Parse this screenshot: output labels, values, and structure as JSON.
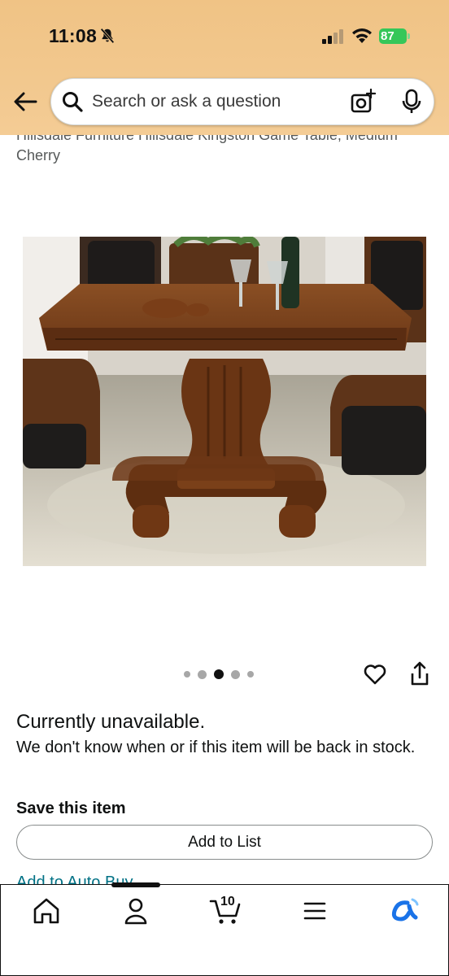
{
  "status_bar": {
    "time": "11:08",
    "battery": "87"
  },
  "search": {
    "placeholder": "Search or ask a question"
  },
  "product": {
    "title": "Hillsdale Furniture Hillsdale Kingston Game Table, Medium Cherry",
    "image_description": "Octagonal wood game table with pedestal base and leather chairs",
    "carousel": {
      "count": 5,
      "active_index": 2
    }
  },
  "availability": {
    "status": "Currently unavailable.",
    "message": "We don't know when or if this item will be back in stock."
  },
  "save": {
    "heading": "Save this item",
    "add_to_list_label": "Add to List",
    "partial_link": "Add to Auto Buy"
  },
  "tab_bar": {
    "cart_count": "10",
    "items": [
      {
        "icon": "home-icon"
      },
      {
        "icon": "account-icon"
      },
      {
        "icon": "cart-icon"
      },
      {
        "icon": "menu-icon"
      },
      {
        "icon": "rufus-icon"
      }
    ],
    "accent_color": "#1a73e8"
  },
  "colors": {
    "header_bg": "#f2c88e",
    "link": "#007185",
    "battery": "#35c759"
  }
}
